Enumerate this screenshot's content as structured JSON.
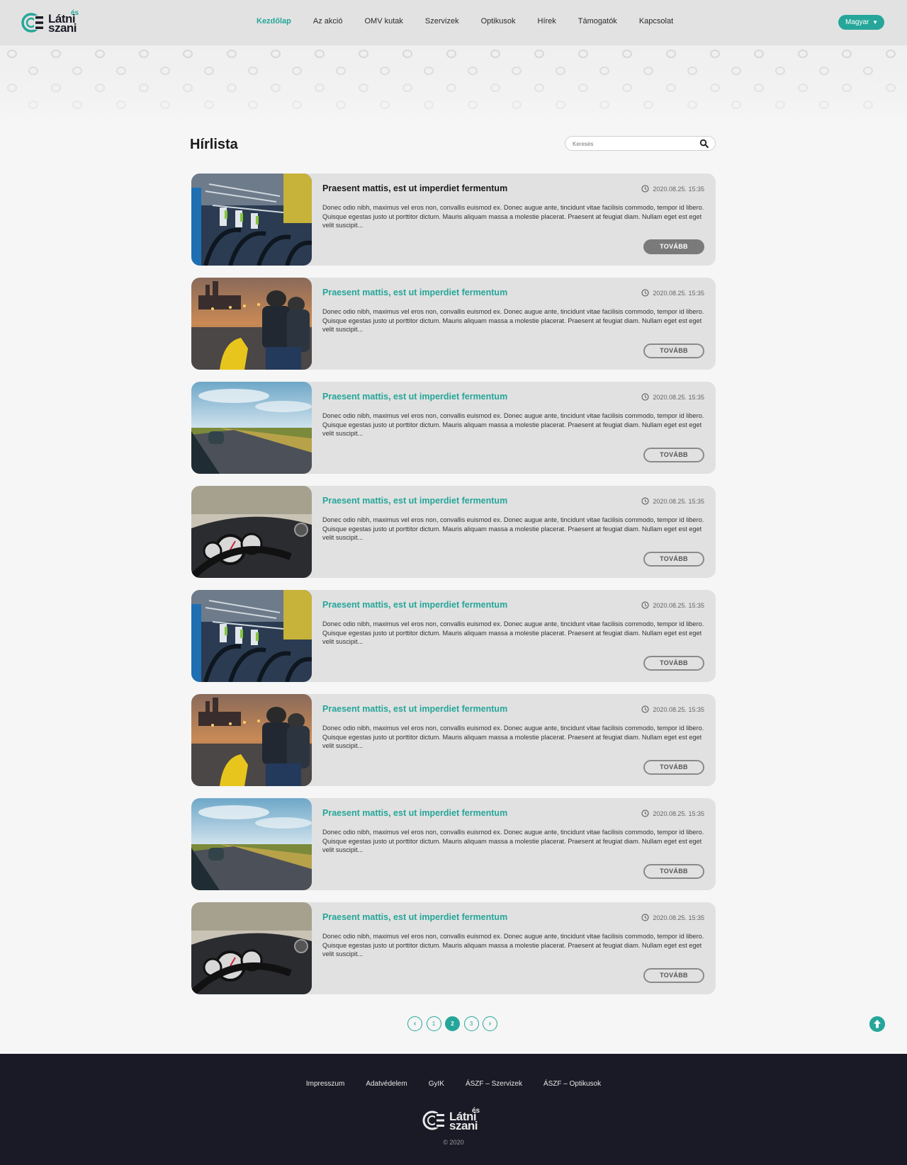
{
  "brand": {
    "logo_word_top": "Látni",
    "logo_word_bottom": "szani",
    "logo_es": "és",
    "accent": "#26a69a",
    "dark": "#1a1a26"
  },
  "nav": {
    "items": [
      {
        "label": "Kezdőlap"
      },
      {
        "label": "Az akció"
      },
      {
        "label": "OMV kutak"
      },
      {
        "label": "Szervizek"
      },
      {
        "label": "Optikusok"
      },
      {
        "label": "Hírek"
      },
      {
        "label": "Támogatók"
      },
      {
        "label": "Kapcsolat"
      }
    ],
    "language": "Magyar"
  },
  "page": {
    "title": "Hírlista",
    "search_placeholder": "Keresés"
  },
  "news": [
    {
      "image": "bikes",
      "title": "Praesent mattis, est ut imperdiet fermentum",
      "date": "2020.08.25. 15:35",
      "excerpt": "Donec odio nibh, maximus vel eros non, convallis euismod ex. Donec augue ante, tincidunt vitae facilisis commodo, tempor id libero. Quisque egestas justo ut porttitor dictum. Mauris aliquam massa a molestie placerat. Praesent at feugiat diam. Nullam eget est eget velit suscipit...",
      "button": "TOVÁBB"
    },
    {
      "image": "scooter",
      "title": "Praesent mattis, est ut imperdiet fermentum",
      "date": "2020.08.25. 15:35",
      "excerpt": "Donec odio nibh, maximus vel eros non, convallis euismod ex. Donec augue ante, tincidunt vitae facilisis commodo, tempor id libero. Quisque egestas justo ut porttitor dictum. Mauris aliquam massa a molestie placerat. Praesent at feugiat diam. Nullam eget est eget velit suscipit...",
      "button": "TOVÁBB"
    },
    {
      "image": "road",
      "title": "Praesent mattis, est ut imperdiet fermentum",
      "date": "2020.08.25. 15:35",
      "excerpt": "Donec odio nibh, maximus vel eros non, convallis euismod ex. Donec augue ante, tincidunt vitae facilisis commodo, tempor id libero. Quisque egestas justo ut porttitor dictum. Mauris aliquam massa a molestie placerat. Praesent at feugiat diam. Nullam eget est eget velit suscipit...",
      "button": "TOVÁBB"
    },
    {
      "image": "dashboard",
      "title": "Praesent mattis, est ut imperdiet fermentum",
      "date": "2020.08.25. 15:35",
      "excerpt": "Donec odio nibh, maximus vel eros non, convallis euismod ex. Donec augue ante, tincidunt vitae facilisis commodo, tempor id libero. Quisque egestas justo ut porttitor dictum. Mauris aliquam massa a molestie placerat. Praesent at feugiat diam. Nullam eget est eget velit suscipit...",
      "button": "TOVÁBB"
    },
    {
      "image": "bikes",
      "title": "Praesent mattis, est ut imperdiet fermentum",
      "date": "2020.08.25. 15:35",
      "excerpt": "Donec odio nibh, maximus vel eros non, convallis euismod ex. Donec augue ante, tincidunt vitae facilisis commodo, tempor id libero. Quisque egestas justo ut porttitor dictum. Mauris aliquam massa a molestie placerat. Praesent at feugiat diam. Nullam eget est eget velit suscipit...",
      "button": "TOVÁBB"
    },
    {
      "image": "scooter",
      "title": "Praesent mattis, est ut imperdiet fermentum",
      "date": "2020.08.25. 15:35",
      "excerpt": "Donec odio nibh, maximus vel eros non, convallis euismod ex. Donec augue ante, tincidunt vitae facilisis commodo, tempor id libero. Quisque egestas justo ut porttitor dictum. Mauris aliquam massa a molestie placerat. Praesent at feugiat diam. Nullam eget est eget velit suscipit...",
      "button": "TOVÁBB"
    },
    {
      "image": "road",
      "title": "Praesent mattis, est ut imperdiet fermentum",
      "date": "2020.08.25. 15:35",
      "excerpt": "Donec odio nibh, maximus vel eros non, convallis euismod ex. Donec augue ante, tincidunt vitae facilisis commodo, tempor id libero. Quisque egestas justo ut porttitor dictum. Mauris aliquam massa a molestie placerat. Praesent at feugiat diam. Nullam eget est eget velit suscipit...",
      "button": "TOVÁBB"
    },
    {
      "image": "dashboard",
      "title": "Praesent mattis, est ut imperdiet fermentum",
      "date": "2020.08.25. 15:35",
      "excerpt": "Donec odio nibh, maximus vel eros non, convallis euismod ex. Donec augue ante, tincidunt vitae facilisis commodo, tempor id libero. Quisque egestas justo ut porttitor dictum. Mauris aliquam massa a molestie placerat. Praesent at feugiat diam. Nullam eget est eget velit suscipit...",
      "button": "TOVÁBB"
    }
  ],
  "pagination": {
    "prev_icon": "chevron-left-icon",
    "pages": [
      "1",
      "2",
      "3"
    ],
    "current": "2",
    "next_icon": "chevron-right-icon"
  },
  "footer": {
    "links": [
      {
        "label": "Impresszum"
      },
      {
        "label": "Adatvédelem"
      },
      {
        "label": "GyIK"
      },
      {
        "label": "ÁSZF – Szervizek"
      },
      {
        "label": "ÁSZF – Optikusok"
      }
    ],
    "copyright": "© 2020"
  }
}
